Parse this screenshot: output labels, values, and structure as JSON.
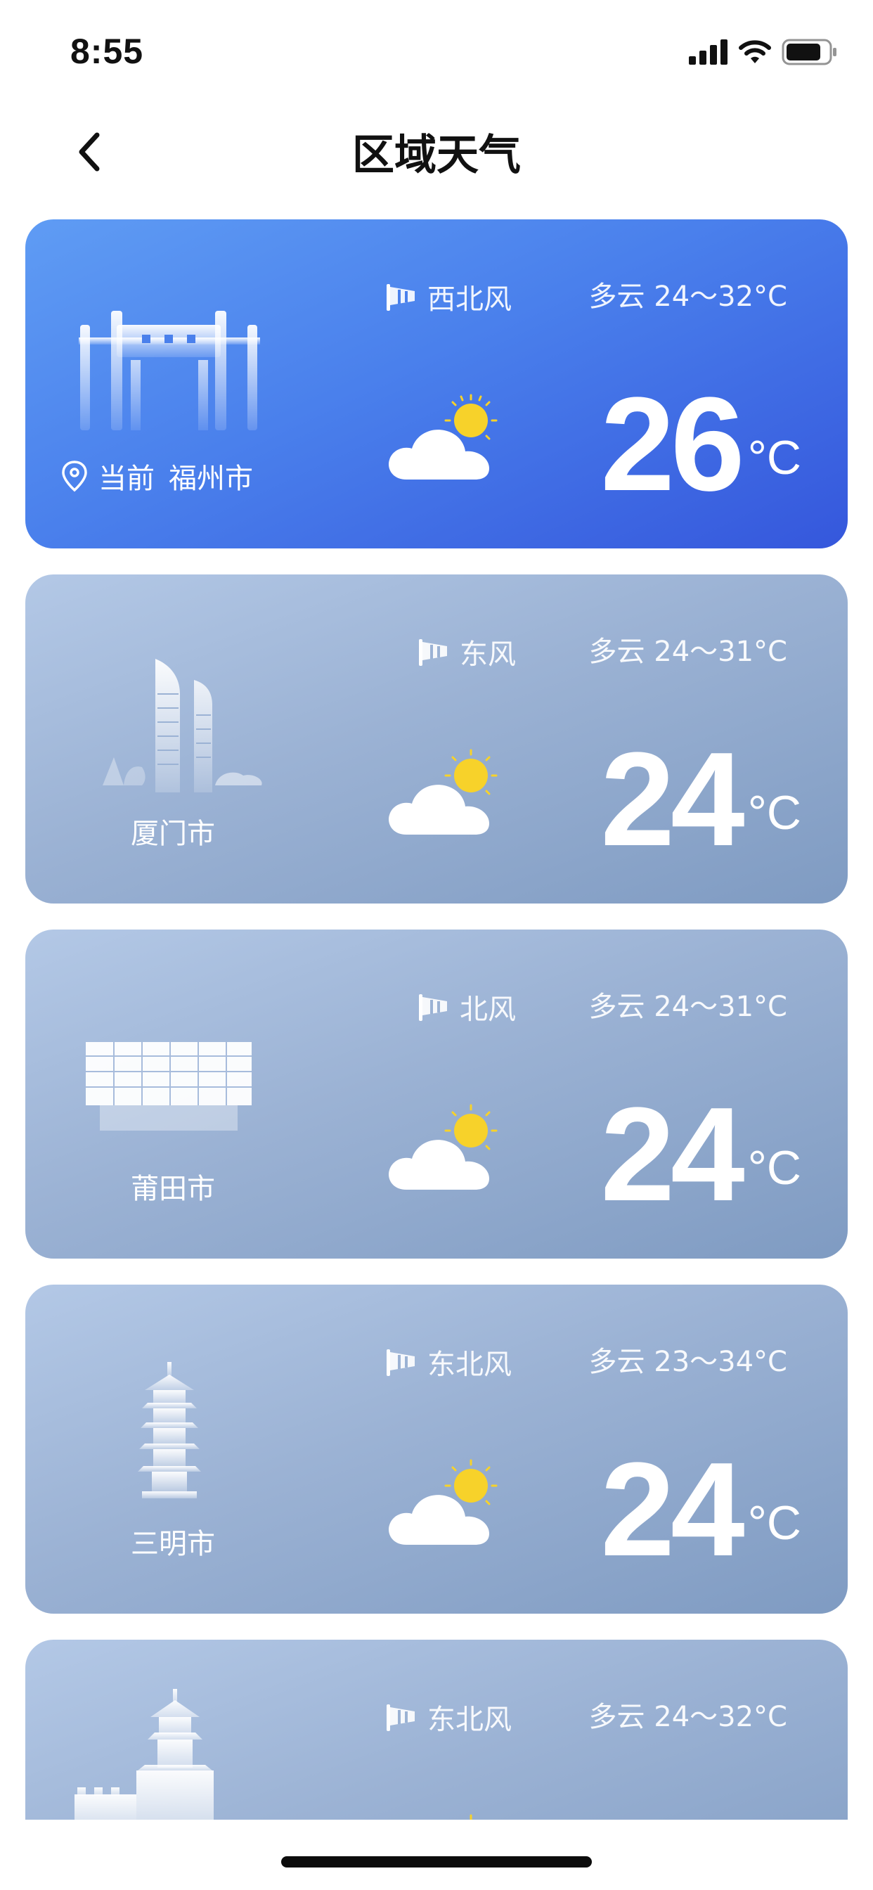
{
  "status_bar": {
    "time": "8:55"
  },
  "nav": {
    "title": "区域天气"
  },
  "cards": [
    {
      "prefix": "当前",
      "city": "福州市",
      "wind": "西北风",
      "forecast": "多云 24～32°C",
      "temp": "26",
      "unit": "°C",
      "landmark": "gate-landmark-icon"
    },
    {
      "city": "厦门市",
      "wind": "东风",
      "forecast": "多云 24～31°C",
      "temp": "24",
      "unit": "°C",
      "landmark": "towers-landmark-icon"
    },
    {
      "city": "莆田市",
      "wind": "北风",
      "forecast": "多云 24～31°C",
      "temp": "24",
      "unit": "°C",
      "landmark": "building-landmark-icon"
    },
    {
      "city": "三明市",
      "wind": "东北风",
      "forecast": "多云 23～34°C",
      "temp": "24",
      "unit": "°C",
      "landmark": "pagoda-landmark-icon"
    },
    {
      "wind": "东北风",
      "forecast": "多云 24～32°C",
      "landmark": "pavilion-landmark-icon"
    }
  ],
  "colors": {
    "current_card": "#4a80ec",
    "card": "#9bb2d4",
    "sun": "#f7d22a"
  }
}
